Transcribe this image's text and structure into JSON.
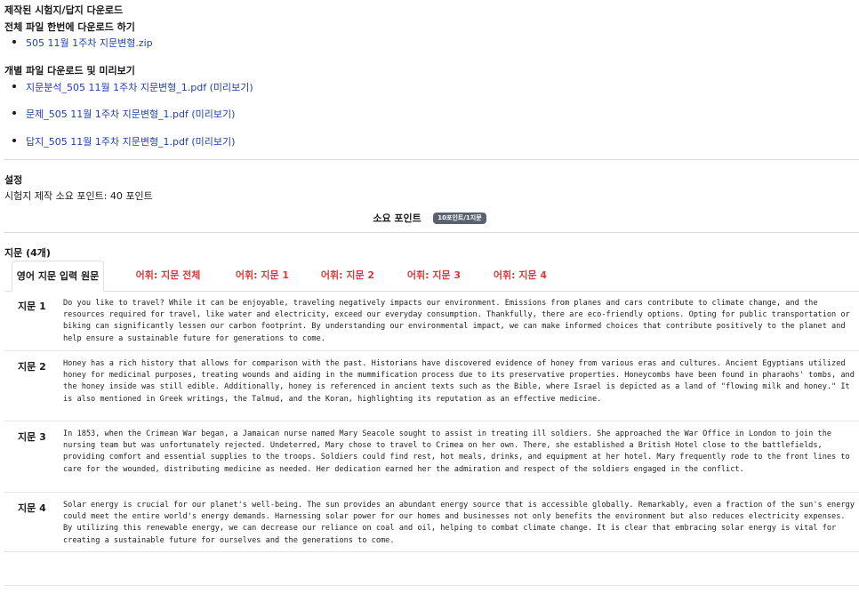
{
  "downloads": {
    "title": "제작된 시험지/답지 다운로드",
    "all_at_once_label": "전체 파일 한번에 다운로드 하기",
    "zip_file": "505 11월 1주차 지문변형.zip",
    "individual_label": "개별 파일 다운로드 및 미리보기",
    "files": [
      "지문분석_505 11월 1주차 지문변형_1.pdf (미리보기)",
      "문제_505 11월 1주차 지문변형_1.pdf (미리보기)",
      "답지_505 11월 1주차 지문변형_1.pdf (미리보기)"
    ]
  },
  "settings": {
    "title": "설정",
    "points_info": "시험지 제작 소요 포인트: 40 포인트",
    "points_label": "소요 포인트",
    "points_badge": "10포인트/1지문"
  },
  "passages": {
    "title": "지문 (4개)",
    "tabs": [
      "영어 지문 입력 원문",
      "어휘: 지문 전체",
      "어휘: 지문 1",
      "어휘: 지문 2",
      "어휘: 지문 3",
      "어휘: 지문 4"
    ],
    "items": [
      {
        "label": "지문 1",
        "text": "Do you like to travel? While it can be enjoyable, traveling negatively impacts our environment. Emissions from planes and cars contribute to climate change, and the resources required for travel, like water and electricity, exceed our everyday consumption. Thankfully, there are eco-friendly options. Opting for public transportation or biking can significantly lessen our carbon footprint. By understanding our environmental impact, we can make informed choices that contribute positively to the planet and help ensure a sustainable future for generations to come."
      },
      {
        "label": "지문 2",
        "text": "Honey has a rich history that allows for comparison with the past. Historians have discovered evidence of honey from various eras and cultures. Ancient Egyptians utilized honey for medicinal purposes, treating wounds and aiding in the mummification process due to its preservative properties. Honeycombs have been found in pharaohs' tombs, and the honey inside was still edible. Additionally, honey is referenced in ancient texts such as the Bible, where Israel is depicted as a land of \"flowing milk and honey.\" It is also mentioned in Greek writings, the Talmud, and the Koran, highlighting its reputation as an effective medicine."
      },
      {
        "label": "지문 3",
        "text": "In 1853, when the Crimean War began, a Jamaican nurse named Mary Seacole sought to assist in treating ill soldiers. She approached the War Office in London to join the nursing team but was unfortunately rejected. Undeterred, Mary chose to travel to Crimea on her own. There, she established a British Hotel close to the battlefields, providing comfort and essential supplies to the troops. Soldiers could find rest, hot meals, drinks, and equipment at her hotel. Mary frequently rode to the front lines to care for the wounded, distributing medicine as needed. Her dedication earned her the admiration and respect of the soldiers engaged in the conflict."
      },
      {
        "label": "지문 4",
        "text": "Solar energy is crucial for our planet's well-being. The sun provides an abundant energy source that is accessible globally. Remarkably, even a fraction of the sun's energy could meet the entire world's energy demands. Harnessing solar power for our homes and businesses not only benefits the environment but also reduces electricity expenses. By utilizing this renewable energy, we can decrease our reliance on coal and oil, helping to combat climate change. It is clear that embracing solar energy is vital for creating a sustainable future for ourselves and the generations to come."
      }
    ]
  }
}
